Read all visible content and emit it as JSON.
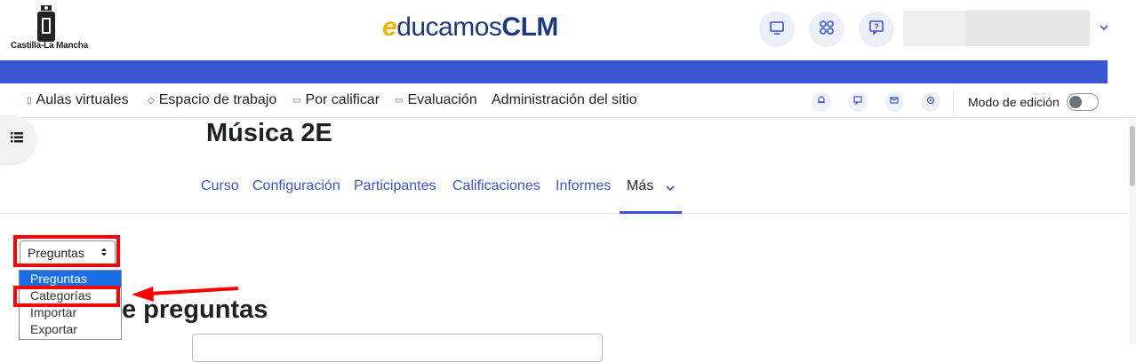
{
  "header": {
    "org_logo_text": "Castilla-La Mancha",
    "brand": {
      "e": "e",
      "main": "ducamos",
      "bold": "CLM"
    },
    "icons": [
      "desktop-icon",
      "apps-icon",
      "help-icon"
    ],
    "user_menu_caret": "⌄"
  },
  "primary_nav": {
    "items": [
      {
        "label": "Aulas virtuales",
        "icon": "▯"
      },
      {
        "label": "Espacio de trabajo",
        "icon": "◇"
      },
      {
        "label": "Por calificar",
        "icon": "▭"
      },
      {
        "label": "Evaluación",
        "icon": "▭"
      },
      {
        "label": "Administración del sitio"
      }
    ],
    "edit_mode_label": "Modo de edición"
  },
  "course": {
    "title": "Música 2E",
    "tabs": [
      "Curso",
      "Configuración",
      "Participantes",
      "Calificaciones",
      "Informes",
      "Más"
    ]
  },
  "question_bank": {
    "select_value": "Preguntas",
    "options": [
      "Preguntas",
      "Categorías",
      "Importar",
      "Exportar"
    ],
    "heading_partial": "e preguntas"
  },
  "colors": {
    "accent": "#3a55d0",
    "annotation": "#ff0000",
    "selected_option": "#1a6fe8"
  }
}
